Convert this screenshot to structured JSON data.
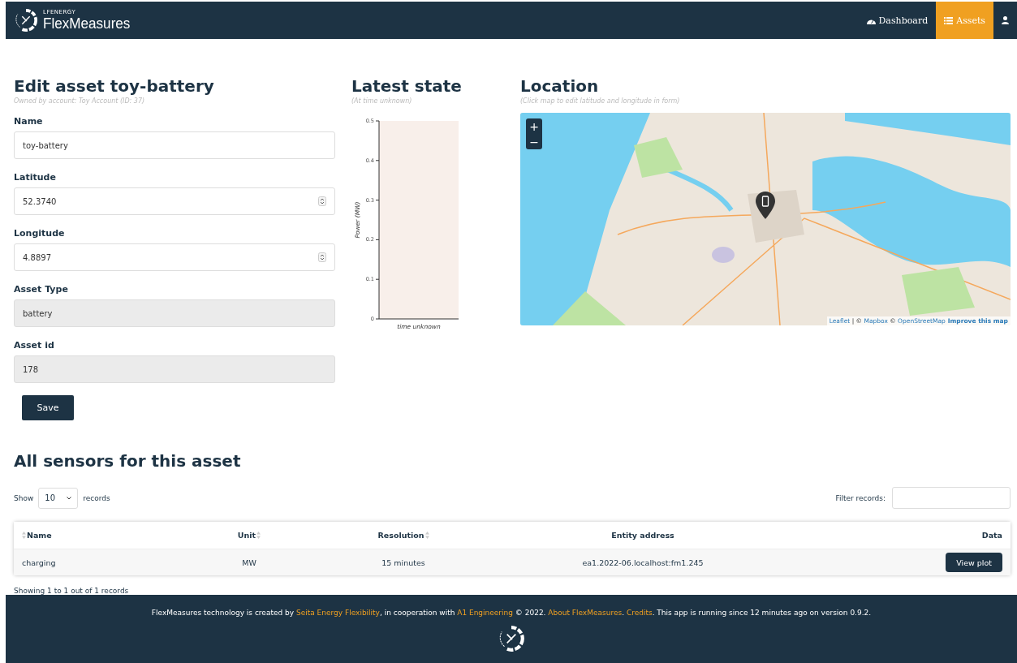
{
  "navbar": {
    "brand_top": "LFENERGY",
    "brand": "FlexMeasures",
    "items": [
      {
        "label": "Dashboard",
        "kind": "dashboard",
        "selected": false
      },
      {
        "label": "Assets",
        "kind": "assets",
        "selected": true
      },
      {
        "kind": "user",
        "selected": false
      }
    ]
  },
  "form": {
    "title": "Edit asset toy-battery",
    "subtitle": "Owned by account: Toy Account (ID: 37)",
    "fields": [
      {
        "label": "Name",
        "value": "toy-battery",
        "kind": "text",
        "disabled": false
      },
      {
        "label": "Latitude",
        "value": "52.3740",
        "kind": "number",
        "disabled": false
      },
      {
        "label": "Longitude",
        "value": "4.8897",
        "kind": "number",
        "disabled": false
      },
      {
        "label": "Asset Type",
        "value": "battery",
        "kind": "text",
        "disabled": true
      },
      {
        "label": "Asset id",
        "value": "178",
        "kind": "text",
        "disabled": true
      }
    ],
    "save": "Save"
  },
  "latest_state": {
    "title": "Latest state",
    "subtitle": "(At time unknown)",
    "chart_data": {
      "type": "bar",
      "ylabel": "Power (MW)",
      "categories": [
        "time unknown"
      ],
      "values": [
        null
      ],
      "ylim": [
        0,
        0.5
      ],
      "yticks": [
        0,
        0.1,
        0.2,
        0.3,
        0.4,
        0.5
      ]
    }
  },
  "location": {
    "title": "Location",
    "subtitle": "(Click map to edit latitude and longitude in form)",
    "zoom_in": "+",
    "zoom_out": "−",
    "attribution": [
      {
        "text": "Leaflet",
        "kind": "link"
      },
      {
        "text": " | © ",
        "kind": "text"
      },
      {
        "text": "Mapbox",
        "kind": "link"
      },
      {
        "text": " © ",
        "kind": "text"
      },
      {
        "text": "OpenStreetMap",
        "kind": "link"
      },
      {
        "text": "Improve this map",
        "kind": "strong_link"
      }
    ]
  },
  "sensors": {
    "title": "All sensors for this asset",
    "show_label": "Show",
    "page_size": "10",
    "records_label": "records",
    "filter_label": "Filter records:",
    "columns": [
      {
        "label": "Name",
        "kind": "sortable"
      },
      {
        "label": "Unit",
        "kind": "sortable"
      },
      {
        "label": "Resolution",
        "kind": "sortable"
      },
      {
        "label": "Entity address",
        "kind": "plain"
      },
      {
        "label": "Data",
        "kind": "plain"
      }
    ],
    "rows": [
      {
        "name": "charging",
        "unit": "MW",
        "resolution": "15 minutes",
        "entity_address": "ea1.2022-06.localhost:fm1.245",
        "action": "View plot"
      }
    ],
    "info": "Showing 1 to 1 out of 1 records"
  },
  "footer": {
    "parts": [
      {
        "text": "FlexMeasures technology is created by ",
        "kind": "text"
      },
      {
        "text": "Seita Energy Flexibility",
        "kind": "link"
      },
      {
        "text": ", in cooperation with ",
        "kind": "text"
      },
      {
        "text": "A1 Engineering",
        "kind": "link"
      },
      {
        "text": " © 2022. ",
        "kind": "text"
      },
      {
        "text": "About FlexMeasures",
        "kind": "link"
      },
      {
        "text": ". ",
        "kind": "text"
      },
      {
        "text": "Credits",
        "kind": "link"
      },
      {
        "text": ". This app is running since 12 minutes ago on version 0.9.2.",
        "kind": "text"
      }
    ]
  }
}
